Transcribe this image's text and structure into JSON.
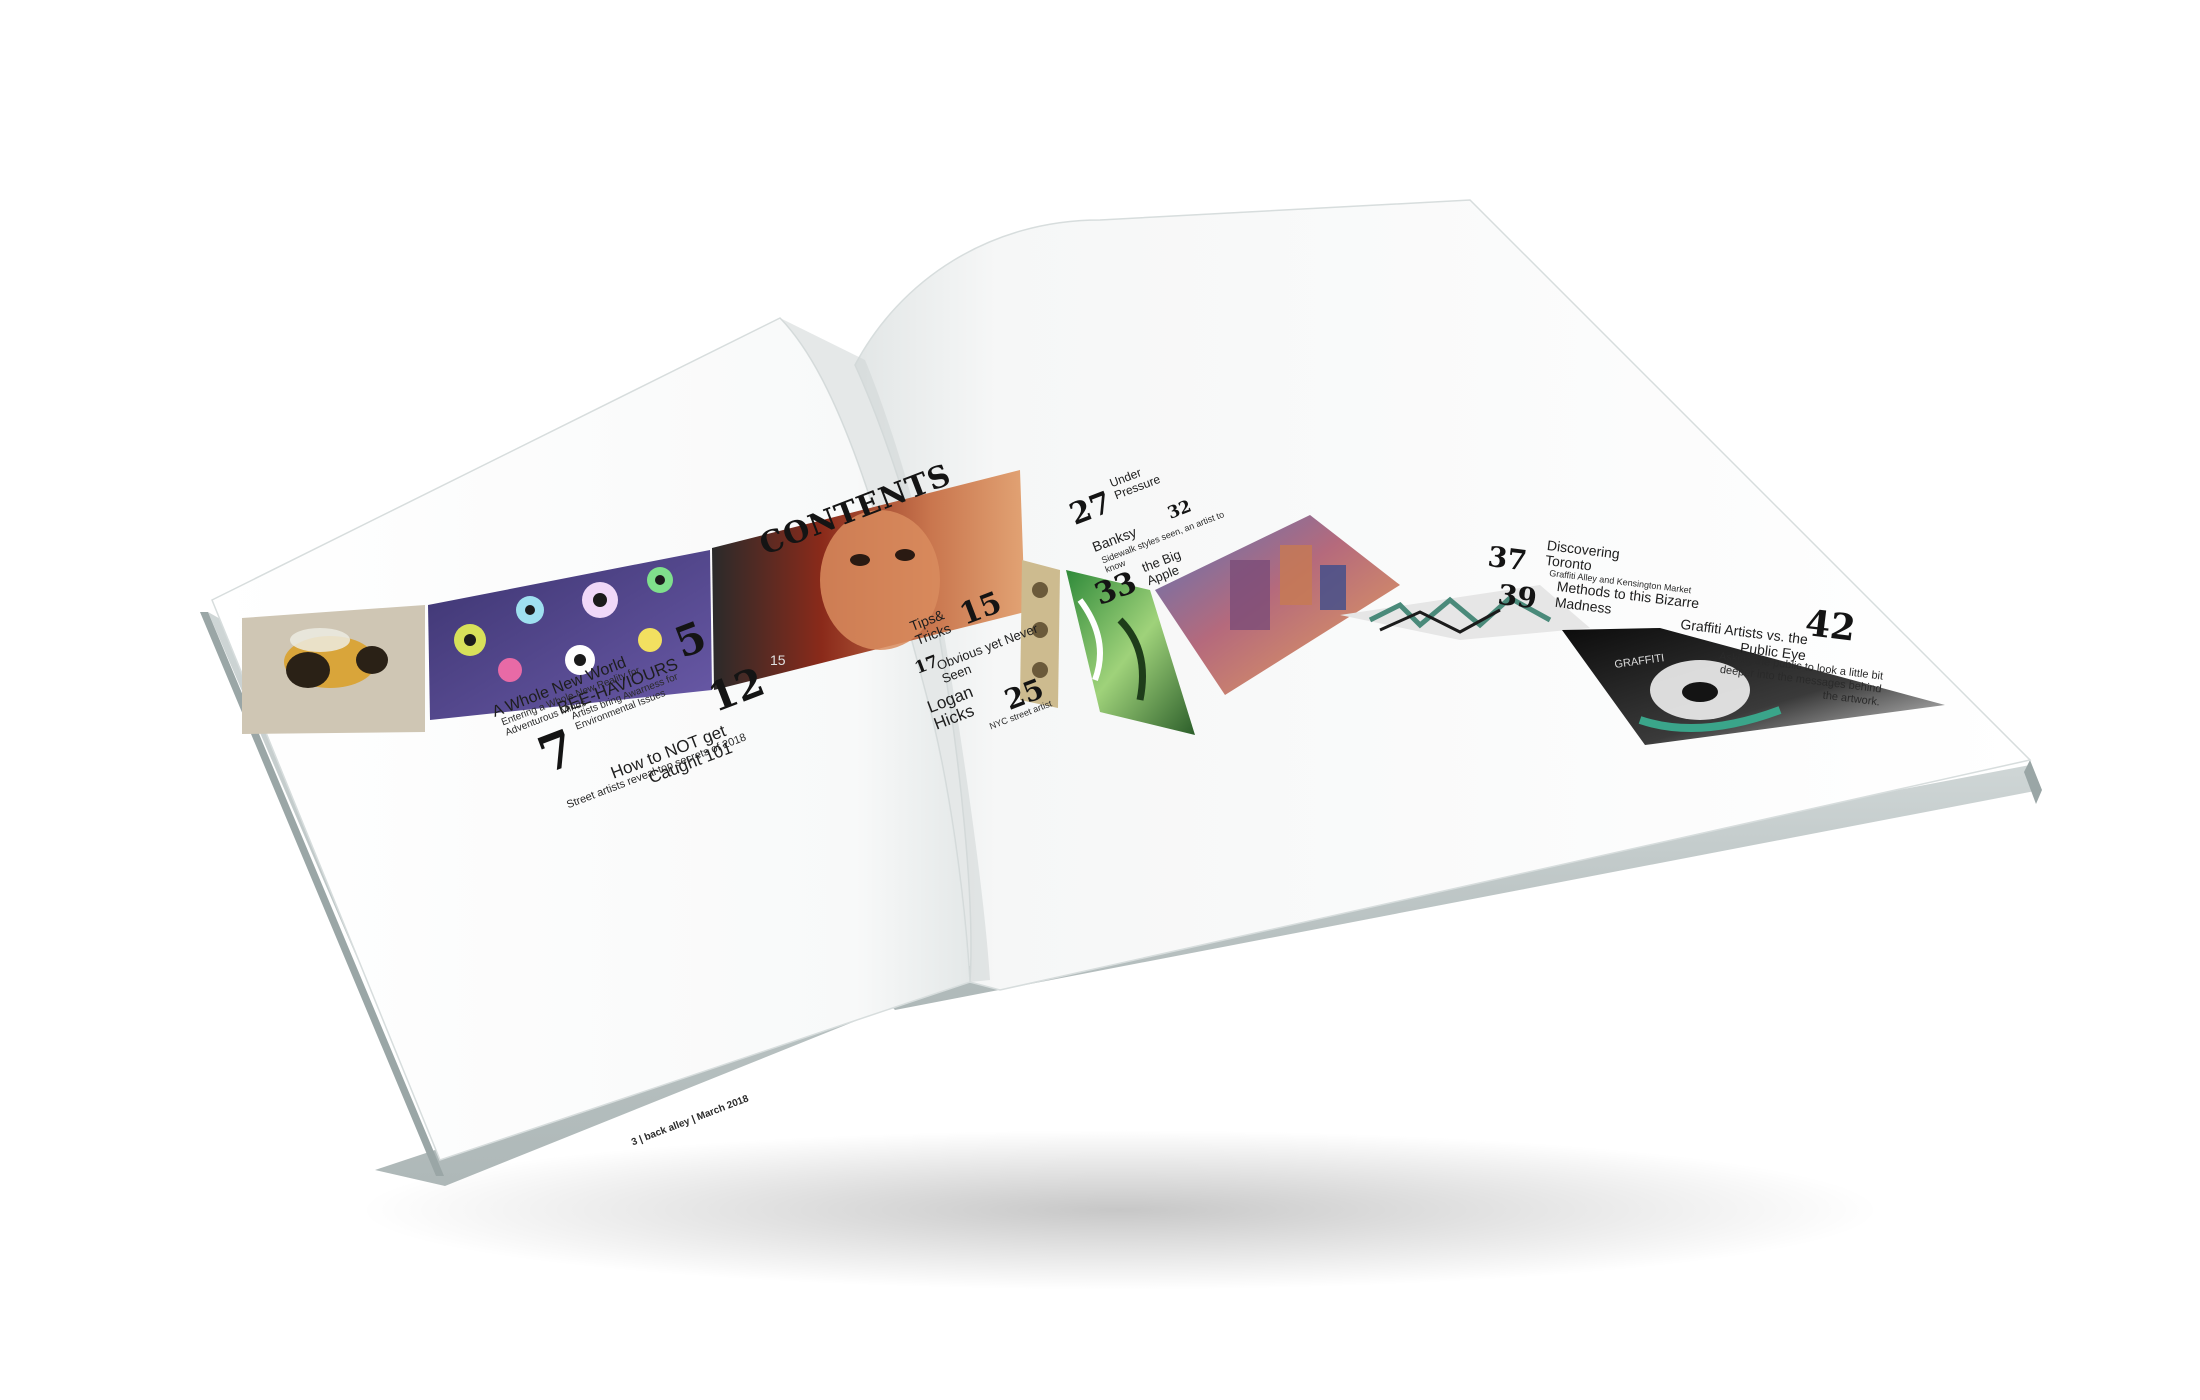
{
  "magazine": {
    "heading": "CONTENTS",
    "footer": "3 | back alley | March 2018"
  },
  "left_entries": [
    {
      "num": "5",
      "title": "A Whole New World",
      "sub": "Entering a Whole New Reality for Adventurous Minds"
    },
    {
      "num": "7",
      "title": "BEE-HAVIOURS",
      "sub": "Artists bring Awarness for Environmental Issues"
    },
    {
      "num": "12",
      "title": "How to NOT get Caught 101",
      "sub": "Street artists reveal top secrets of 2018"
    },
    {
      "num": "15",
      "title": "Tips& Tricks"
    },
    {
      "num": "17",
      "title": "Obvious yet Never Seen"
    },
    {
      "num": "25",
      "title": "Logan Hicks",
      "sub": "NYC street artist"
    }
  ],
  "right_entries": [
    {
      "num": "27",
      "title": "Under Pressure"
    },
    {
      "num": "32",
      "title": "Banksy",
      "sub": "Sidewalk styles seen, an artist to know"
    },
    {
      "num": "33",
      "title": "the Big Apple"
    },
    {
      "num": "37",
      "title": "Discovering Toronto",
      "sub": "Graffiti Alley and Kensington Market"
    },
    {
      "num": "39",
      "title": "Methods to this Bizarre Madness"
    },
    {
      "num": "42",
      "title": "Graffiti Artists vs. the Public Eye",
      "sub": "Asking the public to look a little bit deeper into the messages behind the artwork."
    }
  ],
  "photos": [
    {
      "subject": "bee-mural",
      "label": ""
    },
    {
      "subject": "purple-cartoon-mural",
      "label": ""
    },
    {
      "subject": "woman-face-mural",
      "label": "15"
    },
    {
      "subject": "skull-pattern-strip",
      "label": ""
    },
    {
      "subject": "green-graffiti-wall",
      "label": ""
    },
    {
      "subject": "city-painting",
      "label": ""
    },
    {
      "subject": "graffiti-letters",
      "label": ""
    },
    {
      "subject": "black-white-face",
      "label": "GRAFFITI"
    }
  ]
}
